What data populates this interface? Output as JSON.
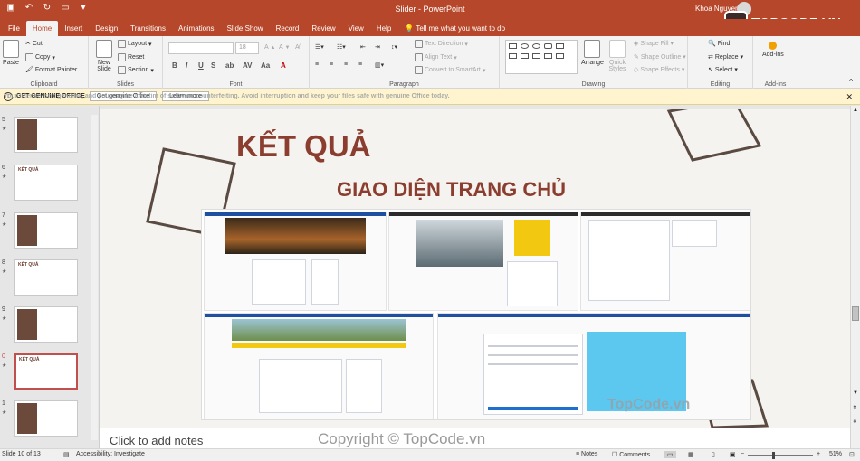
{
  "titlebar": {
    "title": "Slider - PowerPoint",
    "user": "Khoa Nguyen"
  },
  "tabs": [
    "File",
    "Home",
    "Insert",
    "Design",
    "Transitions",
    "Animations",
    "Slide Show",
    "Record",
    "Review",
    "View",
    "Help"
  ],
  "tell_me": "Tell me what you want to do",
  "ribbon": {
    "clipboard": {
      "paste": "Paste",
      "cut": "Cut",
      "copy": "Copy",
      "format_painter": "Format Painter",
      "label": "Clipboard"
    },
    "slides": {
      "new_slide": "New Slide",
      "layout": "Layout",
      "reset": "Reset",
      "section": "Section",
      "label": "Slides"
    },
    "font": {
      "size": "18",
      "label": "Font"
    },
    "paragraph": {
      "text_direction": "Text Direction",
      "align_text": "Align Text",
      "convert_smartart": "Convert to SmartArt",
      "label": "Paragraph"
    },
    "drawing": {
      "arrange": "Arrange",
      "quick_styles": "Quick Styles",
      "shape_fill": "Shape Fill",
      "shape_outline": "Shape Outline",
      "shape_effects": "Shape Effects",
      "label": "Drawing"
    },
    "editing": {
      "find": "Find",
      "replace": "Replace",
      "select": "Select",
      "label": "Editing"
    },
    "addins": {
      "addins": "Add-ins",
      "label": "Add-ins"
    }
  },
  "warning": {
    "title": "GET GENUINE OFFICE",
    "message": "Your license isn't genuine, and you may be a victim of software counterfeiting. Avoid interruption and keep your files safe with genuine Office today.",
    "button_get": "Get genuine Office",
    "button_learn": "Learn more"
  },
  "thumbnails": [
    {
      "num": "5",
      "title": ""
    },
    {
      "num": "6",
      "title": "KẾT QUẢ"
    },
    {
      "num": "7",
      "title": ""
    },
    {
      "num": "8",
      "title": "KẾT QUẢ"
    },
    {
      "num": "9",
      "title": ""
    },
    {
      "num": "0",
      "title": "KẾT QUẢ"
    },
    {
      "num": "1",
      "title": ""
    }
  ],
  "slide": {
    "title": "KẾT QUẢ",
    "subtitle": "GIAO DIỆN TRANG CHỦ"
  },
  "notes_placeholder": "Click to add notes",
  "watermarks": {
    "corner_logo": "TOPCODE.VN",
    "center": "TopCode.vn",
    "copyright": "Copyright © TopCode.vn"
  },
  "status": {
    "slide_info": "Slide 10 of 13",
    "accessibility": "Accessibility: Investigate",
    "notes": "Notes",
    "comments": "Comments",
    "zoom": "51%"
  },
  "colors": {
    "accent": "#b7472a",
    "slide_title": "#8b3e2f",
    "warning_bg": "#fff4ce"
  }
}
